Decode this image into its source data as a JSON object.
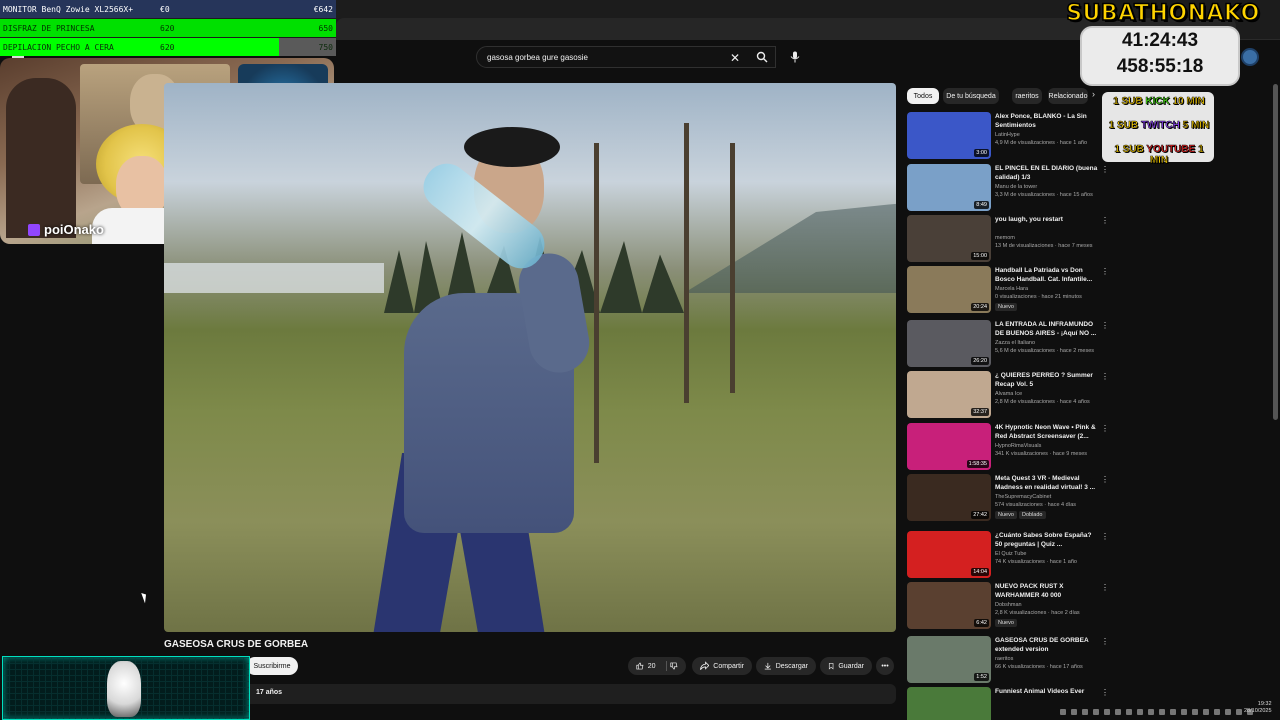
{
  "donation_goals": [
    {
      "name": "MONITOR BenQ Zowie XL2566X+",
      "current": "€0",
      "target": "€642",
      "progress": 0.0
    },
    {
      "name": "DISFRAZ DE PRINCESA",
      "current": "620",
      "target": "650",
      "progress": 1.0
    },
    {
      "name": "DEPILACION PECHO A CERA",
      "current": "620",
      "target": "750",
      "progress": 0.83
    }
  ],
  "webcam": {
    "streamer_tag": "poiOnako"
  },
  "search": {
    "query": "gasosa gorbea gure gasosie"
  },
  "video": {
    "title": "GASEOSA CRUS DE GORBEA",
    "subscribe_label": "Suscribirme",
    "like_count": "20",
    "share_label": "Compartir",
    "download_label": "Descargar",
    "save_label": "Guardar",
    "age": "17 años"
  },
  "chips": [
    "Todos",
    "De tu búsqueda",
    "raeritos",
    "Relacionado"
  ],
  "recommendations": [
    {
      "title": "Alex Ponce, BLANKO - La Sin Sentimientos",
      "channel": "LatinHype",
      "meta": "4,9 M de visualizaciones · hace 1 año",
      "duration": "3:00",
      "thumb": "#3b57c8"
    },
    {
      "title": "EL PINCEL EN EL DIARIO (buena calidad) 1/3",
      "channel": "Manu de la tower",
      "meta": "3,3 M de visualizaciones · hace 15 años",
      "duration": "8:49",
      "thumb": "#7aa0c8"
    },
    {
      "title": "you laugh, you restart",
      "channel": "memom",
      "meta": "13 M de visualizaciones · hace 7 meses",
      "duration": "15:00",
      "thumb": "#4a4038"
    },
    {
      "title": "Handball La Patriada vs Don Bosco Handball.  Cat. Infantile...",
      "channel": "Marcela Hara",
      "meta": "0 visualizaciones · hace 21 minutos",
      "duration": "20:24",
      "badge": "Nuevo",
      "thumb": "#8a7a5a"
    },
    {
      "title": "LA ENTRADA AL INFRAMUNDO DE BUENOS AIRES - ¡Aquí NO ...",
      "channel": "Zazza el Italiano",
      "meta": "5,6 M de visualizaciones · hace 2 meses",
      "duration": "26:20",
      "thumb": "#5a5a60"
    },
    {
      "title": "¿ QUIERES PERREO ? Summer Recap Vol. 5",
      "channel": "Alvama Ice",
      "meta": "2,8 M de visualizaciones · hace 4 años",
      "duration": "32:37",
      "thumb": "#c0a890"
    },
    {
      "title": "4K Hypnotic Neon Wave • Pink & Red Abstract Screensaver (2...",
      "channel": "HypnoRimaVisuals",
      "meta": "341 K visualizaciones · hace 9 meses",
      "duration": "1:58:35",
      "thumb": "#c8207a"
    },
    {
      "title": "Meta Quest 3 VR - Medieval Madness en realidad virtual! 3 ...",
      "channel": "TheSupremacyCabinet",
      "meta": "574 visualizaciones · hace 4 días",
      "duration": "27:42",
      "badge": "Nuevo",
      "badge2": "Doblado",
      "thumb": "#3a2a20"
    },
    {
      "title": "¿Cuánto Sabes Sobre España? 50 preguntas | Quiz ...",
      "channel": "El Quiz Tube",
      "meta": "74 K visualizaciones · hace 1 año",
      "duration": "14:04",
      "thumb": "#d42020"
    },
    {
      "title": "NUEVO PACK RUST X WARHAMMER 40 000",
      "channel": "Dobshman",
      "meta": "2,8 K visualizaciones · hace 2 días",
      "duration": "6:42",
      "badge": "Nuevo",
      "thumb": "#5a4030"
    },
    {
      "title": "GASEOSA CRUS DE GORBEA extended version",
      "channel": "raeritos",
      "meta": "66 K visualizaciones · hace 17 años",
      "duration": "1:52",
      "thumb": "#6a7a6a"
    },
    {
      "title": "Funniest Animal Videos Ever",
      "channel": "",
      "meta": "",
      "duration": "",
      "thumb": "#4a7a3a"
    }
  ],
  "subathon": {
    "title": "SUBATHONAKO",
    "timer_current": "41:24:43",
    "timer_total": "458:55:18",
    "rates": [
      {
        "prefix": "1 SUB ",
        "platform": "KICK",
        "suffix": " 10 MIN",
        "class": "kick"
      },
      {
        "prefix": "1 SUB ",
        "platform": "TWITCH",
        "suffix": " 5 MIN",
        "class": "twitch"
      },
      {
        "prefix": "1 SUB ",
        "platform": "YOUTUBE",
        "suffix": " 1 MIN",
        "class": "youtube"
      }
    ]
  },
  "taskbar": {
    "time": "19:32",
    "date": "28/10/2025"
  }
}
